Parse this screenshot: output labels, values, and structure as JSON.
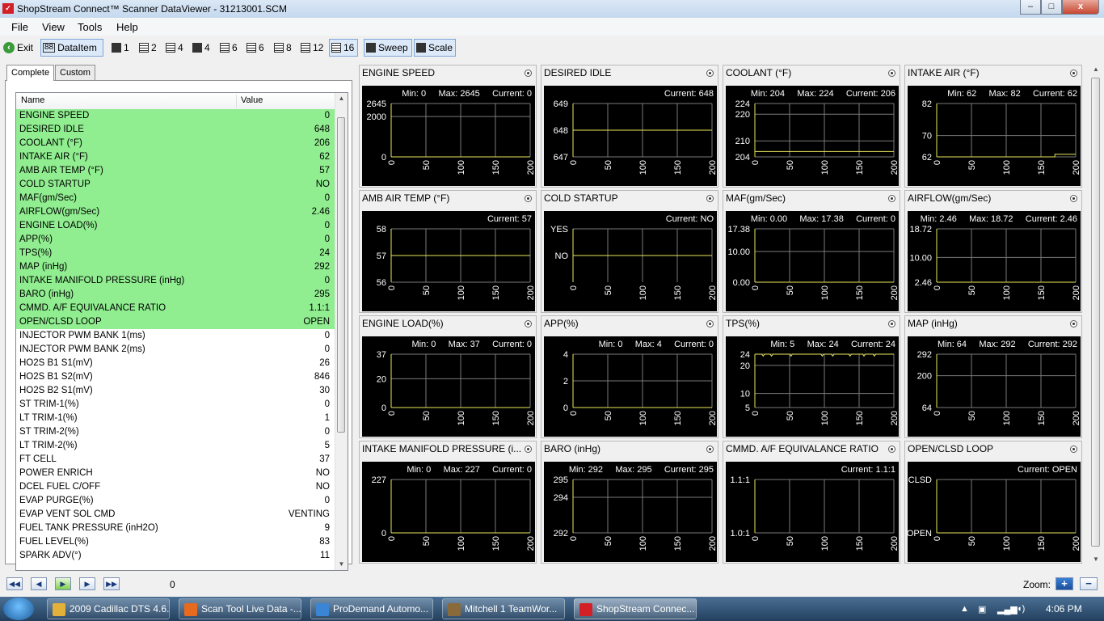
{
  "window": {
    "title": "ShopStream Connect™ Scanner DataViewer - 31213001.SCM",
    "icon": "app-logo-icon",
    "minimize": "–",
    "maximize": "□",
    "close": "x"
  },
  "menu": [
    "File",
    "View",
    "Tools",
    "Help"
  ],
  "toolbar": {
    "exit": "Exit",
    "dataitem": "DataItem",
    "layouts": [
      "1",
      "2",
      "4",
      "4",
      "6",
      "6",
      "8",
      "12",
      "16"
    ],
    "sweep": "Sweep",
    "scale": "Scale"
  },
  "tabs": {
    "complete": "Complete",
    "custom": "Custom"
  },
  "list": {
    "headers": {
      "name": "Name",
      "value": "Value"
    },
    "rows": [
      {
        "name": "ENGINE SPEED",
        "value": "0",
        "highlight": true
      },
      {
        "name": "DESIRED IDLE",
        "value": "648",
        "highlight": true
      },
      {
        "name": "COOLANT (°F)",
        "value": "206",
        "highlight": true
      },
      {
        "name": "INTAKE AIR (°F)",
        "value": "62",
        "highlight": true
      },
      {
        "name": "AMB AIR TEMP (°F)",
        "value": "57",
        "highlight": true
      },
      {
        "name": "COLD STARTUP",
        "value": "NO",
        "highlight": true
      },
      {
        "name": "MAF(gm/Sec)",
        "value": "0",
        "highlight": true
      },
      {
        "name": "AIRFLOW(gm/Sec)",
        "value": "2.46",
        "highlight": true
      },
      {
        "name": "ENGINE LOAD(%)",
        "value": "0",
        "highlight": true
      },
      {
        "name": "APP(%)",
        "value": "0",
        "highlight": true
      },
      {
        "name": "TPS(%)",
        "value": "24",
        "highlight": true
      },
      {
        "name": "MAP (inHg)",
        "value": "292",
        "highlight": true
      },
      {
        "name": "INTAKE MANIFOLD PRESSURE (inHg)",
        "value": "0",
        "highlight": true
      },
      {
        "name": "BARO (inHg)",
        "value": "295",
        "highlight": true
      },
      {
        "name": "CMMD. A/F EQUIVALANCE RATIO",
        "value": "1.1:1",
        "highlight": true
      },
      {
        "name": "OPEN/CLSD LOOP",
        "value": "OPEN",
        "highlight": true
      },
      {
        "name": "INJECTOR PWM BANK 1(ms)",
        "value": "0",
        "highlight": false
      },
      {
        "name": "INJECTOR PWM BANK 2(ms)",
        "value": "0",
        "highlight": false
      },
      {
        "name": "HO2S B1 S1(mV)",
        "value": "26",
        "highlight": false
      },
      {
        "name": "HO2S B1 S2(mV)",
        "value": "846",
        "highlight": false
      },
      {
        "name": "HO2S B2 S1(mV)",
        "value": "30",
        "highlight": false
      },
      {
        "name": "ST TRIM-1(%)",
        "value": "0",
        "highlight": false
      },
      {
        "name": "LT TRIM-1(%)",
        "value": "1",
        "highlight": false
      },
      {
        "name": "ST TRIM-2(%)",
        "value": "0",
        "highlight": false
      },
      {
        "name": "LT TRIM-2(%)",
        "value": "5",
        "highlight": false
      },
      {
        "name": "FT CELL",
        "value": "37",
        "highlight": false
      },
      {
        "name": "POWER ENRICH",
        "value": "NO",
        "highlight": false
      },
      {
        "name": "DCEL FUEL C/OFF",
        "value": "NO",
        "highlight": false
      },
      {
        "name": "EVAP PURGE(%)",
        "value": "0",
        "highlight": false
      },
      {
        "name": "EVAP VENT SOL CMD",
        "value": "VENTING",
        "highlight": false
      },
      {
        "name": "FUEL TANK PRESSURE  (inH2O)",
        "value": "9",
        "highlight": false
      },
      {
        "name": "FUEL LEVEL(%)",
        "value": "83",
        "highlight": false
      },
      {
        "name": "SPARK ADV(°)",
        "value": "11",
        "highlight": false
      }
    ]
  },
  "graphs": [
    {
      "title": "ENGINE SPEED",
      "stats": "Min: 0     Max: 2645     Current: 0",
      "ylabels": [
        {
          "t": "2645",
          "v": 2645
        },
        {
          "t": "2000",
          "v": 2000
        },
        {
          "t": "0",
          "v": 0
        }
      ],
      "ymin": 0,
      "ymax": 2645,
      "trace": [
        [
          0,
          0
        ],
        [
          200,
          0
        ]
      ]
    },
    {
      "title": "DESIRED IDLE",
      "stats": "Current: 648",
      "ylabels": [
        {
          "t": "649",
          "v": 649
        },
        {
          "t": "648",
          "v": 648
        },
        {
          "t": "647",
          "v": 647
        }
      ],
      "ymin": 647,
      "ymax": 649,
      "trace": [
        [
          0,
          648
        ],
        [
          200,
          648
        ]
      ]
    },
    {
      "title": "COOLANT (°F)",
      "stats": "Min: 204     Max: 224     Current: 206",
      "ylabels": [
        {
          "t": "224",
          "v": 224
        },
        {
          "t": "220",
          "v": 220
        },
        {
          "t": "210",
          "v": 210
        },
        {
          "t": "204",
          "v": 204
        }
      ],
      "ymin": 204,
      "ymax": 224,
      "trace": [
        [
          0,
          206
        ],
        [
          200,
          206
        ]
      ]
    },
    {
      "title": "INTAKE AIR (°F)",
      "stats": "Min: 62     Max: 82     Current: 62",
      "ylabels": [
        {
          "t": "82",
          "v": 82
        },
        {
          "t": "70",
          "v": 70
        },
        {
          "t": "62",
          "v": 62
        }
      ],
      "ymin": 62,
      "ymax": 82,
      "trace": [
        [
          0,
          62
        ],
        [
          170,
          62
        ],
        [
          170,
          63
        ],
        [
          200,
          63
        ]
      ]
    },
    {
      "title": "AMB AIR TEMP (°F)",
      "stats": "Current: 57",
      "ylabels": [
        {
          "t": "58",
          "v": 58
        },
        {
          "t": "57",
          "v": 57
        },
        {
          "t": "56",
          "v": 56
        }
      ],
      "ymin": 56,
      "ymax": 58,
      "trace": [
        [
          0,
          57
        ],
        [
          200,
          57
        ]
      ]
    },
    {
      "title": "COLD STARTUP",
      "stats": "Current: NO",
      "ylabels": [
        {
          "t": "YES",
          "v": 2
        },
        {
          "t": "NO",
          "v": 1
        }
      ],
      "ymin": 0,
      "ymax": 2,
      "trace": [
        [
          0,
          1
        ],
        [
          200,
          1
        ]
      ]
    },
    {
      "title": "MAF(gm/Sec)",
      "stats": "Min: 0.00     Max: 17.38     Current: 0",
      "ylabels": [
        {
          "t": "17.38",
          "v": 17.38
        },
        {
          "t": "10.00",
          "v": 10
        },
        {
          "t": "0.00",
          "v": 0
        }
      ],
      "ymin": 0,
      "ymax": 17.38,
      "trace": [
        [
          0,
          0
        ],
        [
          200,
          0
        ]
      ]
    },
    {
      "title": "AIRFLOW(gm/Sec)",
      "stats": "Min: 2.46     Max: 18.72     Current: 2.46",
      "ylabels": [
        {
          "t": "18.72",
          "v": 18.72
        },
        {
          "t": "10.00",
          "v": 10
        },
        {
          "t": "2.46",
          "v": 2.46
        }
      ],
      "ymin": 2.46,
      "ymax": 18.72,
      "trace": [
        [
          0,
          2.46
        ],
        [
          200,
          2.46
        ]
      ]
    },
    {
      "title": "ENGINE LOAD(%)",
      "stats": "Min: 0     Max: 37     Current: 0",
      "ylabels": [
        {
          "t": "37",
          "v": 37
        },
        {
          "t": "20",
          "v": 20
        },
        {
          "t": "0",
          "v": 0
        }
      ],
      "ymin": 0,
      "ymax": 37,
      "trace": [
        [
          0,
          0
        ],
        [
          200,
          0
        ]
      ]
    },
    {
      "title": "APP(%)",
      "stats": "Min: 0     Max: 4     Current: 0",
      "ylabels": [
        {
          "t": "4",
          "v": 4
        },
        {
          "t": "2",
          "v": 2
        },
        {
          "t": "0",
          "v": 0
        }
      ],
      "ymin": 0,
      "ymax": 4,
      "trace": [
        [
          0,
          0
        ],
        [
          200,
          0
        ]
      ]
    },
    {
      "title": "TPS(%)",
      "stats": "Min: 5     Max: 24     Current: 24",
      "ylabels": [
        {
          "t": "24",
          "v": 24
        },
        {
          "t": "20",
          "v": 20
        },
        {
          "t": "10",
          "v": 10
        },
        {
          "t": "5",
          "v": 5
        }
      ],
      "ymin": 5,
      "ymax": 24,
      "trace": [
        [
          0,
          24
        ],
        [
          10,
          24
        ],
        [
          12,
          23.3
        ],
        [
          14,
          24
        ],
        [
          22,
          24
        ],
        [
          24,
          23.3
        ],
        [
          26,
          24
        ],
        [
          50,
          24
        ],
        [
          52,
          23.3
        ],
        [
          54,
          24
        ],
        [
          95,
          24
        ],
        [
          97,
          23.3
        ],
        [
          99,
          24
        ],
        [
          110,
          24
        ],
        [
          112,
          23.3
        ],
        [
          114,
          24
        ],
        [
          135,
          24
        ],
        [
          137,
          23.3
        ],
        [
          139,
          24
        ],
        [
          155,
          24
        ],
        [
          157,
          23.3
        ],
        [
          159,
          24
        ],
        [
          170,
          24
        ],
        [
          172,
          23.3
        ],
        [
          174,
          24
        ],
        [
          200,
          24
        ]
      ]
    },
    {
      "title": "MAP (inHg)",
      "stats": "Min: 64     Max: 292     Current: 292",
      "ylabels": [
        {
          "t": "292",
          "v": 292
        },
        {
          "t": "200",
          "v": 200
        },
        {
          "t": "64",
          "v": 64
        }
      ],
      "ymin": 64,
      "ymax": 292,
      "trace": []
    },
    {
      "title": "INTAKE MANIFOLD PRESSURE (i...",
      "stats": "Min: 0     Max: 227     Current: 0",
      "ylabels": [
        {
          "t": "227",
          "v": 227
        },
        {
          "t": "0",
          "v": 0
        }
      ],
      "ymin": 0,
      "ymax": 227,
      "trace": [
        [
          0,
          0
        ],
        [
          200,
          0
        ]
      ]
    },
    {
      "title": "BARO (inHg)",
      "stats": "Min: 292     Max: 295     Current: 295",
      "ylabels": [
        {
          "t": "295",
          "v": 295
        },
        {
          "t": "294",
          "v": 294
        },
        {
          "t": "292",
          "v": 292
        }
      ],
      "ymin": 292,
      "ymax": 295,
      "trace": []
    },
    {
      "title": "CMMD. A/F EQUIVALANCE RATIO",
      "stats": "Current: 1.1:1",
      "ylabels": [
        {
          "t": "1.1:1",
          "v": 1.1
        },
        {
          "t": "1.0:1",
          "v": 1.0
        }
      ],
      "ymin": 1.0,
      "ymax": 1.1,
      "trace": []
    },
    {
      "title": "OPEN/CLSD LOOP",
      "stats": "Current: OPEN",
      "ylabels": [
        {
          "t": "CLSD",
          "v": 1
        },
        {
          "t": "OPEN",
          "v": 0
        }
      ],
      "ymin": 0,
      "ymax": 1,
      "trace": [
        [
          0,
          0
        ],
        [
          200,
          0
        ]
      ]
    }
  ],
  "xticks": [
    "0",
    "50",
    "100",
    "150",
    "200"
  ],
  "xmax": 200,
  "colors": {
    "trace": "#e8e85a",
    "grid": "#7a7a7a",
    "highlight": "#90ee90"
  },
  "playback": {
    "position": "0",
    "zoom_label": "Zoom:"
  },
  "taskbar": {
    "items": [
      {
        "label": "2009 Cadillac DTS 4.6...",
        "icon": "folder-icon"
      },
      {
        "label": "Scan Tool Live Data -...",
        "icon": "firefox-icon"
      },
      {
        "label": "ProDemand Automo...",
        "icon": "ie-icon"
      },
      {
        "label": "Mitchell 1 TeamWor...",
        "icon": "mitchell-icon"
      },
      {
        "label": "ShopStream Connec...",
        "icon": "shopstream-icon"
      }
    ],
    "clock": "4:06 PM"
  }
}
